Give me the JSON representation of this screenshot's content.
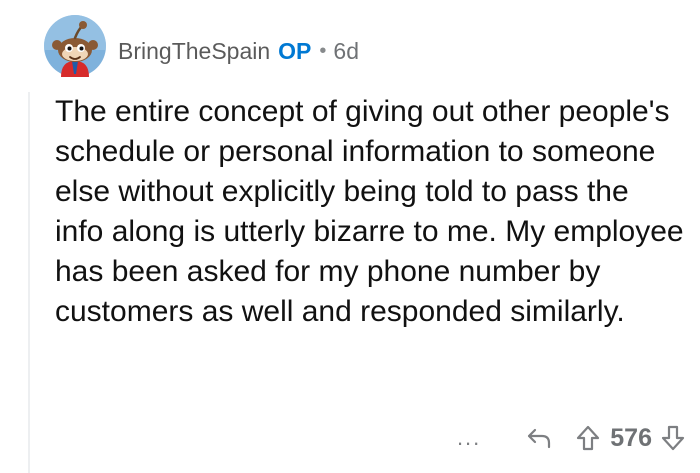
{
  "comment": {
    "author": "BringTheSpain",
    "op_badge": "OP",
    "separator": "•",
    "age": "6d",
    "body": "The entire concept of giving out other people's schedule or personal information to someone else without explicitly being told to pass the info along is utterly bizarre to me. My employee has been asked for my phone number by customers as well and responded similarly.",
    "score": "576"
  },
  "actions": {
    "more": "...",
    "reply_icon": "reply-arrow-icon",
    "upvote_icon": "upvote-arrow-icon",
    "downvote_icon": "downvote-arrow-icon"
  },
  "colors": {
    "op": "#0079d3",
    "muted": "#878a8c",
    "text": "#111111"
  }
}
